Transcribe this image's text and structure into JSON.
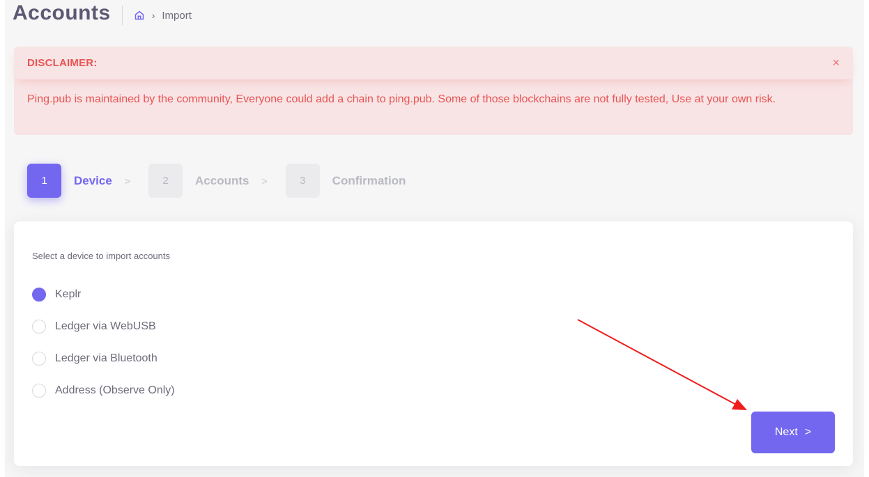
{
  "header": {
    "title": "Accounts",
    "breadcrumb_current": "Import",
    "breadcrumb_separator": "›"
  },
  "alert": {
    "title": "DISCLAIMER:",
    "close_glyph": "×",
    "message": "Ping.pub is maintained by the community, Everyone could add a chain to ping.pub. Some of those blockchains are not fully tested, Use at your own risk."
  },
  "wizard": {
    "separator": ">",
    "steps": [
      {
        "number": "1",
        "label": "Device",
        "active": true
      },
      {
        "number": "2",
        "label": "Accounts",
        "active": false
      },
      {
        "number": "3",
        "label": "Confirmation",
        "active": false
      }
    ]
  },
  "device_form": {
    "label": "Select a device to import accounts",
    "selected": "Keplr",
    "options": [
      {
        "label": "Keplr",
        "checked": true
      },
      {
        "label": "Ledger via WebUSB",
        "checked": false
      },
      {
        "label": "Ledger via Bluetooth",
        "checked": false
      },
      {
        "label": "Address (Observe Only)",
        "checked": false
      }
    ]
  },
  "actions": {
    "next_label": "Next",
    "next_glyph": ">"
  },
  "colors": {
    "primary": "#7367f0",
    "danger": "#ea5455",
    "annotation_arrow": "#ee1c1c"
  },
  "icons": {
    "home": "home-icon",
    "close": "close-icon",
    "arrow": "annotation-arrow"
  }
}
